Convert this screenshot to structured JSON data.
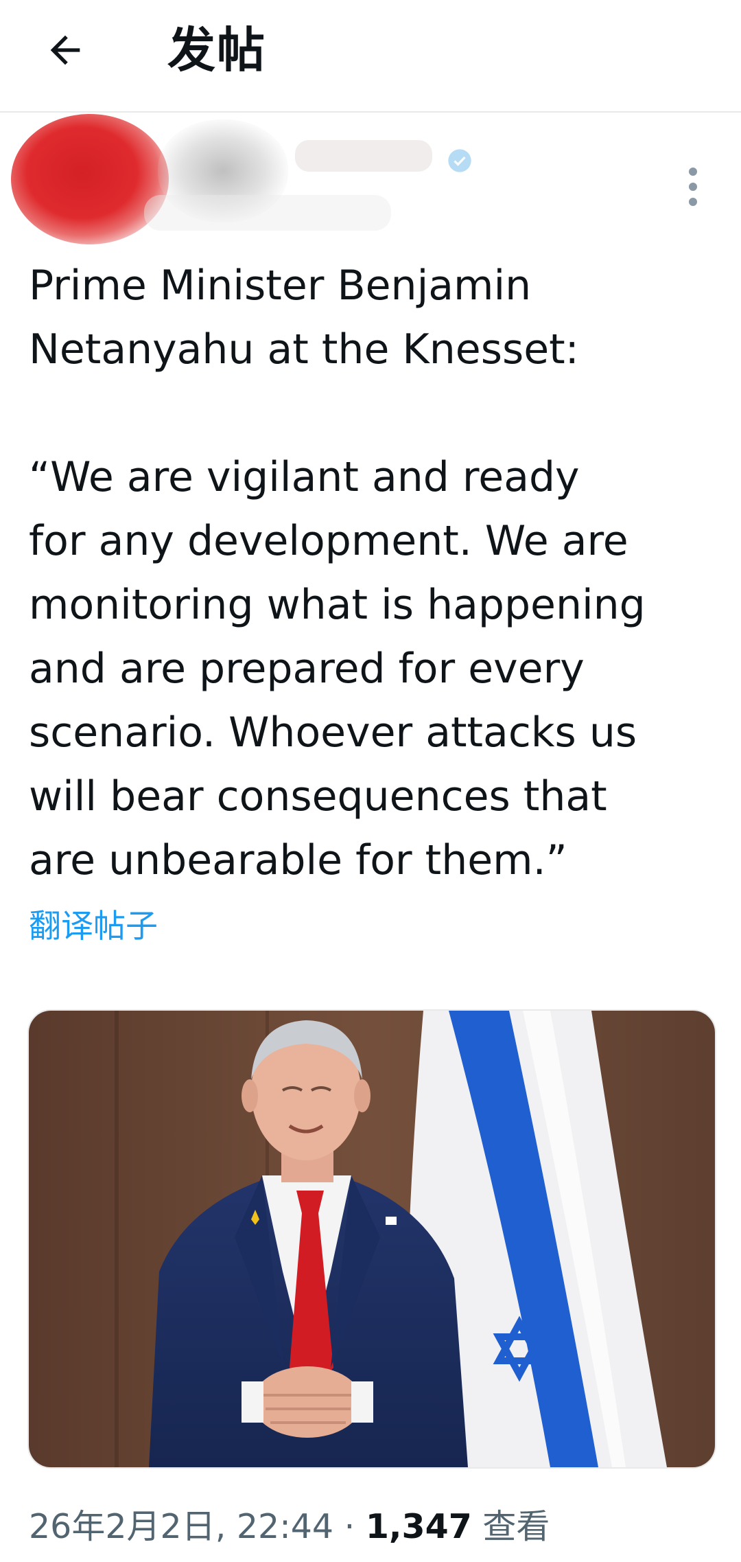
{
  "header": {
    "title": "发帖",
    "back_icon": "arrow-left-icon"
  },
  "author": {
    "verified_icon": "verified-badge-icon",
    "more_icon": "more-vertical-icon"
  },
  "post": {
    "lines": [
      "Prime Minister Benjamin",
      "Netanyahu at the Knesset:",
      "",
      "“We are vigilant and ready",
      "for any development. We are",
      "monitoring what is happening",
      "and are prepared for every",
      "scenario. Whoever attacks us",
      "will bear consequences that",
      "are unbearable for them.”"
    ],
    "translate_label": "翻译帖子"
  },
  "media": {
    "kind": "photo"
  },
  "meta": {
    "timestamp": "26年2月2日, 22:44",
    "separator": "·",
    "views_count": "1,347",
    "views_label": "查看"
  },
  "colors": {
    "link": "#1d9bf0",
    "text": "#0f1419",
    "muted": "#536471",
    "divider": "#e7e9ea",
    "flag_blue": "#1f5fd0"
  }
}
